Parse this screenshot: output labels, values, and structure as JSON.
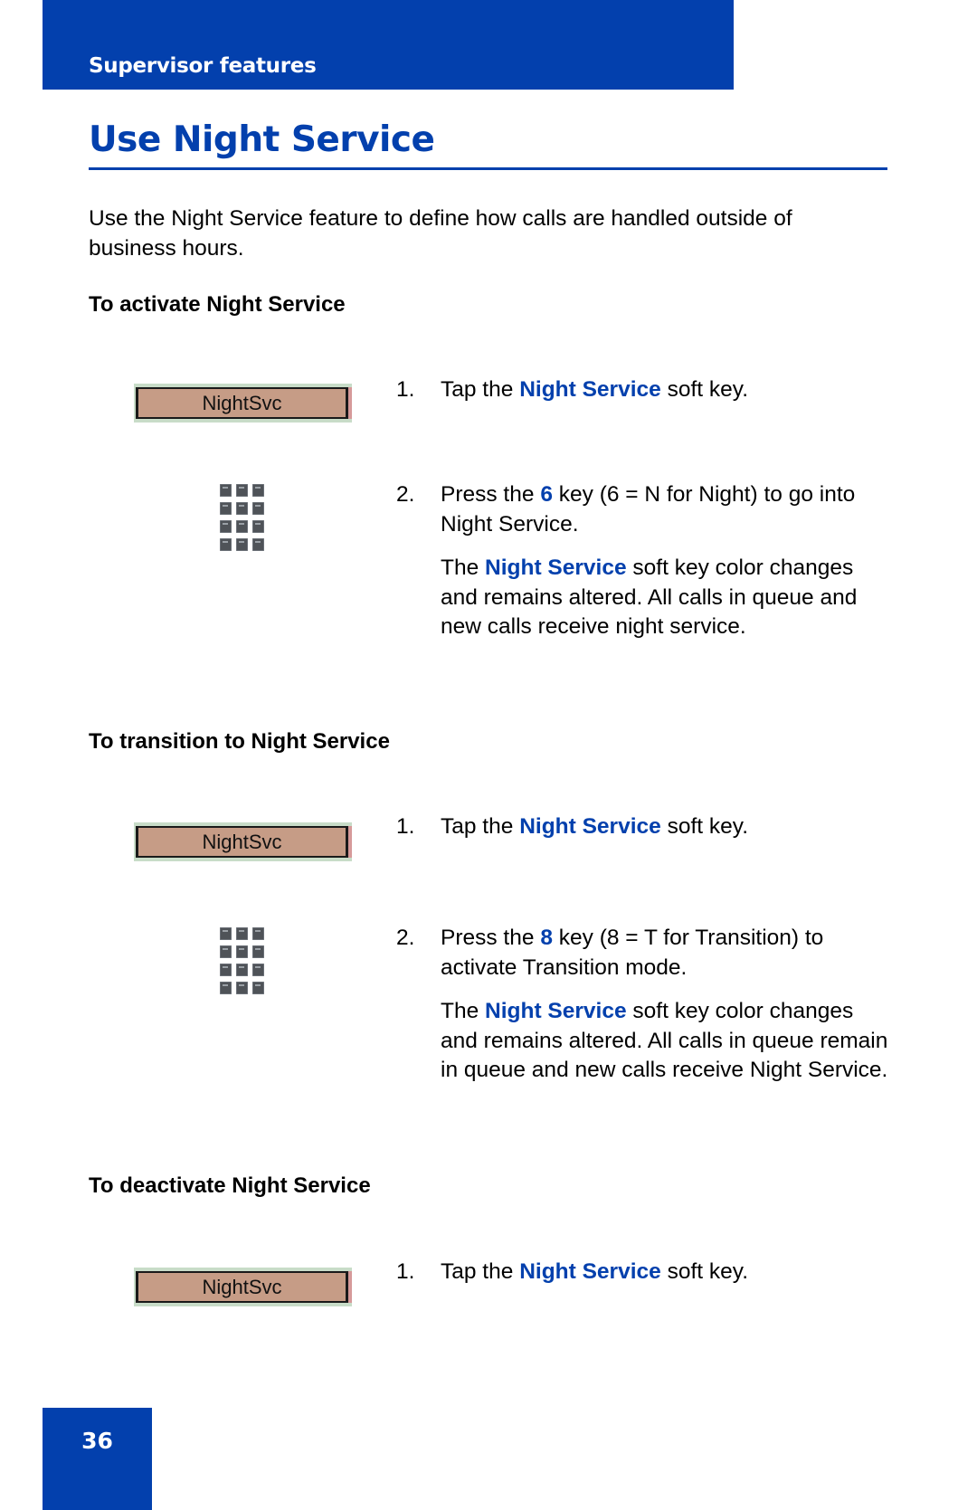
{
  "header": {
    "section_title": "Supervisor features"
  },
  "page": {
    "title": "Use Night Service",
    "intro": "Use the Night Service feature to define how calls are handled outside of business hours.",
    "page_number": "36"
  },
  "colors": {
    "brand_blue": "#0340AD",
    "softkey_fill": "#C69C86",
    "softkey_band": "#C8DCC8"
  },
  "sections": [
    {
      "heading": "To activate Night Service",
      "softkey_label": "NightSvc",
      "step1": {
        "num": "1.",
        "pre": "Tap the ",
        "highlight": "Night Service",
        "post": " soft key."
      },
      "step2": {
        "num": "2.",
        "pre": "Press the ",
        "highlight": "6",
        "post": " key (6 = N for Night) to go into Night Service."
      },
      "note": {
        "pre": "The ",
        "highlight": "Night Service",
        "post": " soft key color changes and remains altered. All calls in queue and new calls receive night service."
      }
    },
    {
      "heading": "To transition to Night Service",
      "softkey_label": "NightSvc",
      "step1": {
        "num": "1.",
        "pre": "Tap the ",
        "highlight": "Night Service",
        "post": " soft key."
      },
      "step2": {
        "num": "2.",
        "pre": "Press the ",
        "highlight": "8",
        "post": " key (8 = T for Transition) to activate Transition mode."
      },
      "note": {
        "pre": "The ",
        "highlight": "Night Service",
        "post": " soft key color changes and remains altered. All calls in queue remain in queue and new calls receive Night Service."
      }
    },
    {
      "heading": "To deactivate Night Service",
      "softkey_label": "NightSvc",
      "step1": {
        "num": "1.",
        "pre": "Tap the ",
        "highlight": "Night Service",
        "post": " soft key."
      }
    }
  ],
  "icons": {
    "keypad": "dialpad-icon",
    "softkey": "softkey-button"
  }
}
